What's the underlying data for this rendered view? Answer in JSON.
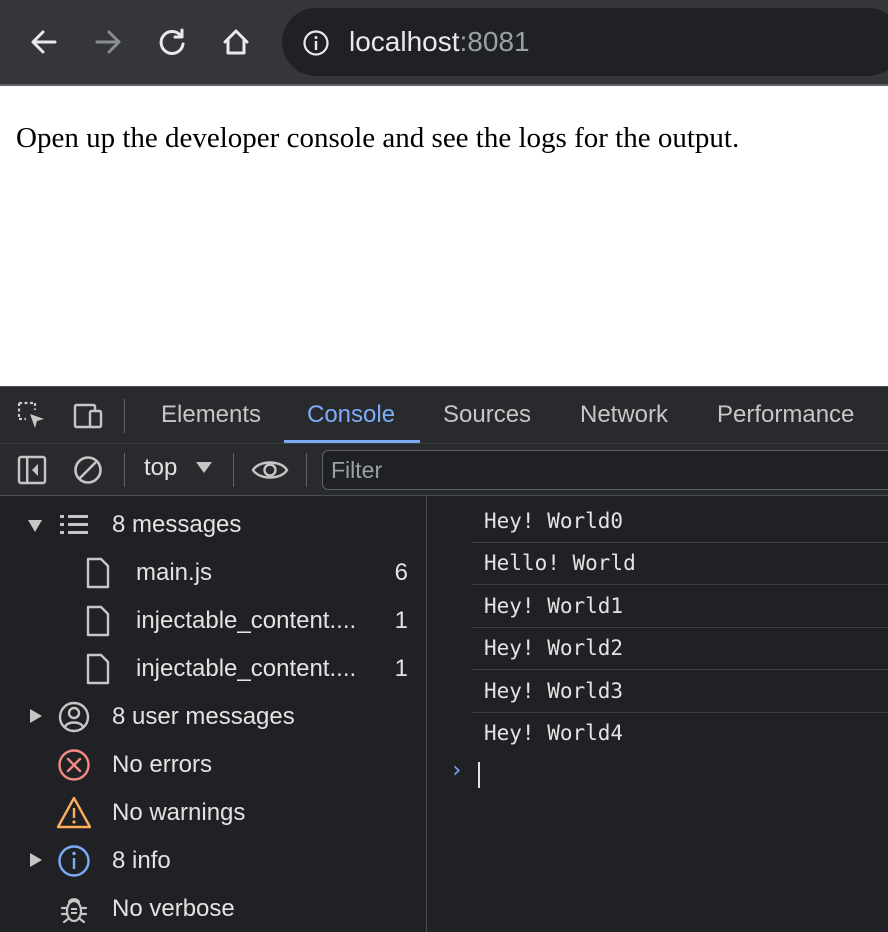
{
  "browser": {
    "url_host": "localhost",
    "url_port": ":8081"
  },
  "page": {
    "text": "Open up the developer console and see the logs for the output."
  },
  "devtools": {
    "tabs": [
      "Elements",
      "Console",
      "Sources",
      "Network",
      "Performance"
    ],
    "active_tab": "Console",
    "context": "top",
    "filter_placeholder": "Filter",
    "sidebar": {
      "messages": {
        "label": "8 messages"
      },
      "files": [
        {
          "name": "main.js",
          "count": "6"
        },
        {
          "name": "injectable_content....",
          "count": "1"
        },
        {
          "name": "injectable_content....",
          "count": "1"
        }
      ],
      "user_messages": "8 user messages",
      "errors": "No errors",
      "warnings": "No warnings",
      "info": "8 info",
      "verbose": "No verbose"
    },
    "logs": [
      "Hey! World0",
      "Hello! World",
      "Hey! World1",
      "Hey! World2",
      "Hey! World3",
      "Hey! World4"
    ],
    "prompt": "›"
  },
  "colors": {
    "accent": "#7cacf8",
    "error": "#f28b82",
    "warning": "#fdae5c",
    "info": "#7cacf8"
  }
}
